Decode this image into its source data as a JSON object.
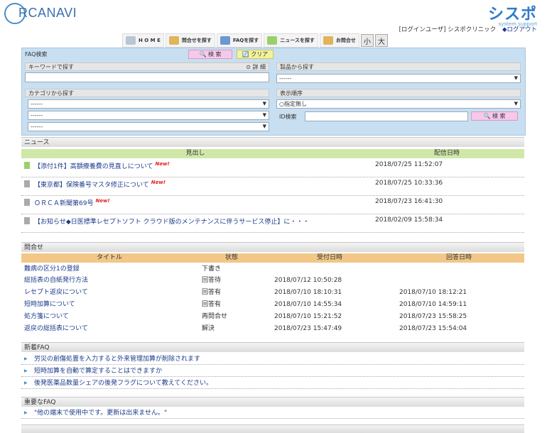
{
  "header": {
    "logo_text": "RCANAVI",
    "brand_name": "シスポ",
    "brand_sub": "system support",
    "user_label": "[ログインユーザ] シスポクリニック",
    "logout_label": "◆ログアウト"
  },
  "nav": {
    "home": "H O M E",
    "find_contact": "問合せを探す",
    "find_faq": "FAQを探す",
    "find_news": "ニュースを探す",
    "contact": "お問合せ",
    "font_small": "小",
    "font_large": "大"
  },
  "faq_search": {
    "title": "FAQ検索",
    "search_btn": "🔍 検 索",
    "clear_btn": "🔄 クリア",
    "keyword_label": "キーワードで探す",
    "detail_label": "⊙ 詳 細",
    "keyword_value": "",
    "product_label": "製品から探す",
    "product_value": "------",
    "category_label": "カテゴリから探す",
    "category_values": [
      "------",
      "------",
      "------"
    ],
    "order_label": "表示順序",
    "order_value": "○指定無し",
    "id_label": "ID検索",
    "id_value": "",
    "id_search_btn": "🔍 検 索"
  },
  "news": {
    "section_title": "ニュース",
    "col_title": "見出し",
    "col_date": "配信日時",
    "new_tag": "New!",
    "items": [
      {
        "title": "【添付1件】高額療養費の見直しについて",
        "is_new": true,
        "date": "2018/07/25 11:52:07"
      },
      {
        "title": "【東京都】保険番号マスタ修正について",
        "is_new": true,
        "date": "2018/07/25 10:33:36"
      },
      {
        "title": "ＯＲＣＡ新聞第69号",
        "is_new": true,
        "date": "2018/07/23 16:41:30"
      },
      {
        "title": "【お知らせ◆日医標準レセプトソフト クラウド版のメンテナンスに伴うサービス停止】に・・・",
        "is_new": false,
        "date": "2018/02/09 15:58:34"
      }
    ]
  },
  "inquiries": {
    "section_title": "問合せ",
    "col_title": "タイトル",
    "col_status": "状態",
    "col_received": "受付日時",
    "col_answered": "回答日時",
    "rows": [
      {
        "title": "難病の区分1の登録",
        "status": "下書き",
        "received": "",
        "answered": ""
      },
      {
        "title": "総括表の自紙発行方法",
        "status": "回答待",
        "received": "2018/07/12 10:50:28",
        "answered": ""
      },
      {
        "title": "レセプト返戻について",
        "status": "回答有",
        "received": "2018/07/10 18:10:31",
        "answered": "2018/07/10 18:12:21"
      },
      {
        "title": "短時加算について",
        "status": "回答有",
        "received": "2018/07/10 14:55:34",
        "answered": "2018/07/10 14:59:11"
      },
      {
        "title": "処方箋について",
        "status": "再問合せ",
        "received": "2018/07/10 15:21:52",
        "answered": "2018/07/23 15:58:25"
      },
      {
        "title": "返戻の総括表について",
        "status": "解決",
        "received": "2018/07/23 15:47:49",
        "answered": "2018/07/23 15:54:04"
      }
    ]
  },
  "new_faq": {
    "section_title": "新着FAQ",
    "items": [
      "労災の創傷処置を入力すると外来管理加算が削除されます",
      "短時加算を自動で算定することはできますか",
      "後発医薬品数量シェアの後発フラグについて教えてください。"
    ]
  },
  "important_faq": {
    "section_title": "重要なFAQ",
    "items": [
      "\"他の端末で使用中です。更新は出来ません。\""
    ]
  },
  "colors": {
    "panel_bg": "#c8dff2",
    "news_header": "#cfe8a8",
    "inquiry_header": "#f2c788",
    "link": "#1a3a8a"
  }
}
